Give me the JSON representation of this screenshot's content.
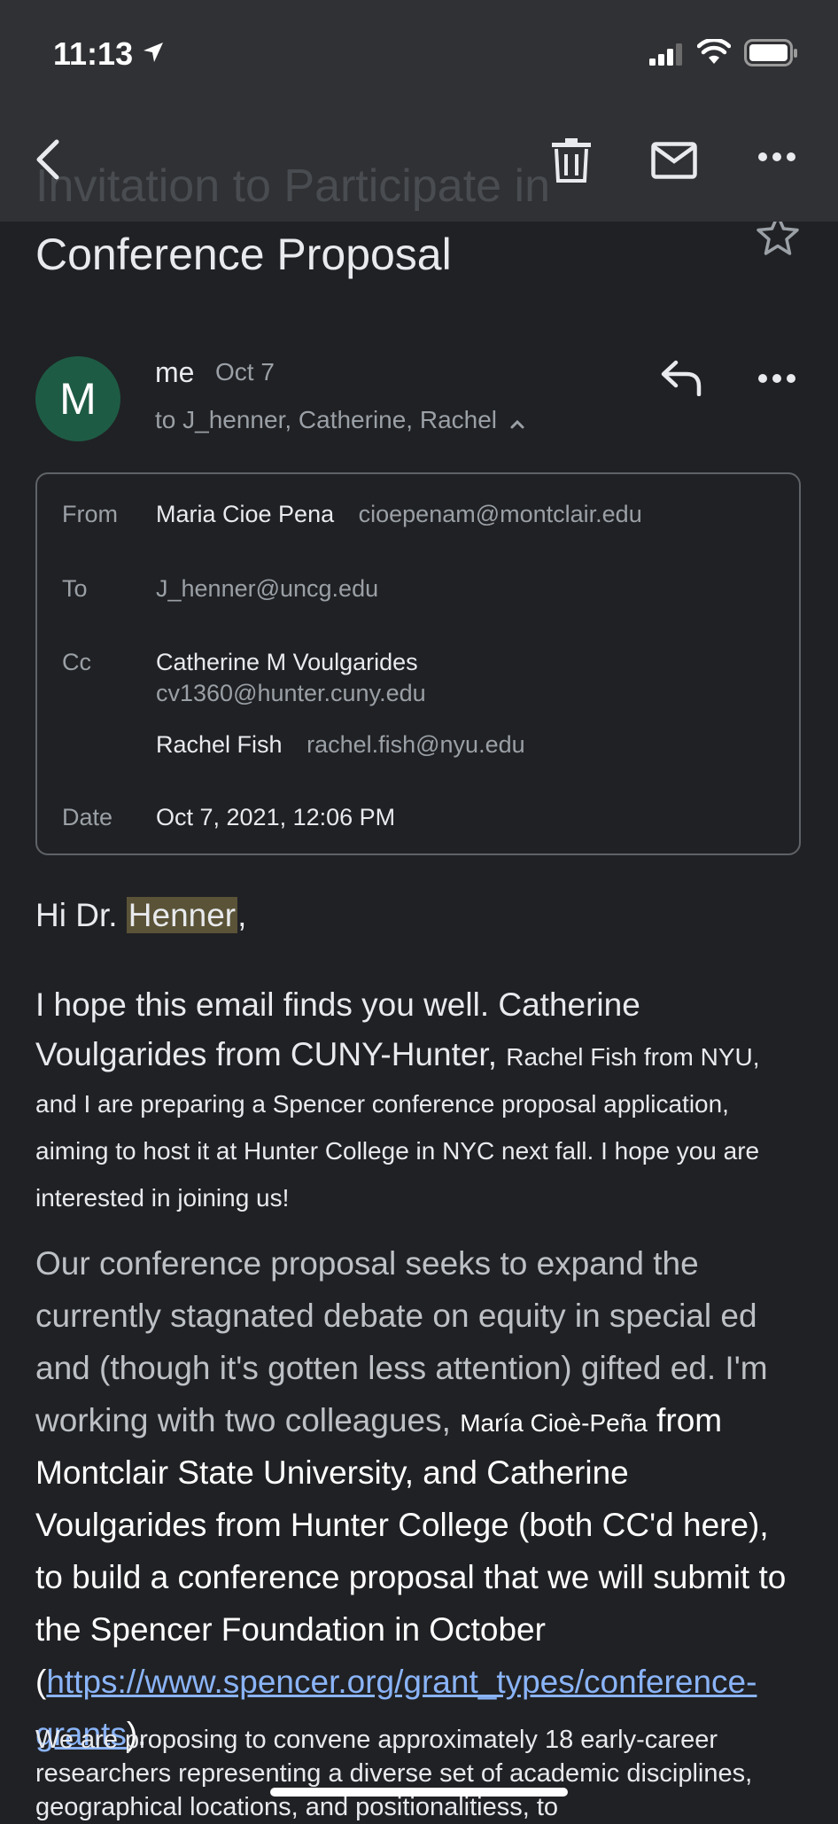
{
  "status": {
    "time": "11:13"
  },
  "header": {
    "ghost_title": "Invitation to Participate in"
  },
  "email": {
    "subject": "Conference Proposal",
    "avatar_letter": "M",
    "sender": "me",
    "date_short": "Oct 7",
    "recipients_line": "to J_henner, Catherine, Rachel",
    "details": {
      "from_label": "From",
      "from_name": "Maria Cioe Pena",
      "from_email": "cioepenam@montclair.edu",
      "to_label": "To",
      "to_email": "J_henner@uncg.edu",
      "cc_label": "Cc",
      "cc1_name": "Catherine M Voulgarides",
      "cc1_email": "cv1360@hunter.cuny.edu",
      "cc2_name": "Rachel Fish",
      "cc2_email": "rachel.fish@nyu.edu",
      "date_label": "Date",
      "date_full": "Oct 7, 2021, 12:06 PM"
    },
    "body": {
      "greeting_pre": "Hi Dr. ",
      "greeting_name": "Henner",
      "greeting_post": ",",
      "p1_big": "I hope this email finds you well. Catherine Voulgarides from CUNY-Hunter, ",
      "p1_small": "Rachel Fish from NYU, and I are preparing a Spencer conference proposal application, aiming to host it at Hunter College in NYC next fall. I hope you are interested in joining us!",
      "p2_a": "Our conference proposal seeks to expand the currently stagnated debate on equity in special ed and (though it's gotten less attention) gifted ed. I'm working with two colleagues, ",
      "p2_small": "María Cioè-Peña",
      "p2_b": " from Montclair State University, and Catherine Voulgarides from Hunter College (both CC'd here), to build a conference proposal that we will submit to the Spencer Foundation in October (",
      "p2_link": "https://www.spencer.org/grant_types/conference-grants",
      "p2_end": ").",
      "p3": "We are proposing to convene approximately 18 early-career researchers representing a diverse set of academic disciplines, geographical locations, and positionalitiess, to"
    }
  }
}
